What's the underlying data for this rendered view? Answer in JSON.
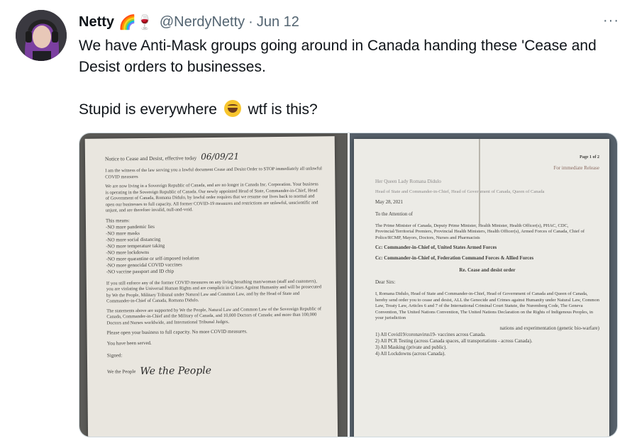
{
  "tweet": {
    "name": "Netty",
    "name_emojis": "🌈🍷",
    "handle": "@NerdyNetty",
    "separator": "·",
    "date": "Jun 12",
    "more": "···",
    "line1": "We have Anti-Mask groups going around in Canada handing these 'Cease and Desist orders to businesses.",
    "line2_a": "Stupid is everywhere",
    "line2_b": "wtf is this?"
  },
  "left_doc": {
    "title": "Notice to Cease and Desist, effective today",
    "date_handwritten": "06/09/21",
    "intro": "I am the witness of the law serving you a lawful document Cease and Desist Order to STOP immediately all unlawful COVID measures",
    "para1": "We are now living in a Sovereign Republic of Canada, and are no longer in Canada Inc. Corporation. Your business is operating in the Sovereign Republic of Canada. Our newly appointed Head of State, Commander-in-Chief, Head of Government of Canada, Romana Didulo, by lawful order requires that we resume our lives back to normal and open our businesses to full capacity. All former COVID-19 measures and restrictions are unlawful, unscientific and unjust, and are therefore invalid, null-and-void.",
    "means": "This means:",
    "list": [
      "-NO more pandemic lies",
      "-NO more masks",
      "-NO more social distancing",
      "-NO more temperature taking",
      "-NO more lockdowns",
      "-NO more quarantine or self-imposed isolation",
      "-NO more genocidal COVID vaccines",
      "-NO vaccine passport and ID chip"
    ],
    "para2": "If you still enforce any of the former COVID measures on any living breathing man/woman (staff and customers), you are violating the Universal Human Rights and are complicit in Crimes Against Humanity and will be prosecuted by We the People, Military Tribunal under Natural Law and Common Law, and by the Head of State and Commander-in-Chief of Canada, Romana Didulo.",
    "para3": "The statements above are supported by We the People, Natural Law and Common Law of the Sovereign Republic of Canada, Commander-in-Chief and the Military of Canada, and 10,000 Doctors of Canada; and more than 100,000 Doctors and Nurses worldwide, and International Tribunal Judges.",
    "para4": "Please open your business to full capacity. No more COVID measures.",
    "served": "You have been served.",
    "signed": "Signed:",
    "we": "We the People",
    "signature": "We the People"
  },
  "right_doc": {
    "page": "Page 1 of 2",
    "release": "For immediate Release",
    "from1": "Her Queen Lady Romana Didulo",
    "from2": "Head of State and Commander-in-Chief, Head of Government of Canada, Queen of Canada",
    "date": "May 28, 2021",
    "attn": "To the Attention of",
    "recipients": "The Prime Minister of Canada, Deputy Prime Minister, Health Minister, Health Officer(s), PHAC, CDC, Provincial/Territorial Premiers, Provincial Health Ministers, Health Officer(s), Armed Forces of Canada, Chief of Police/RCMP, Mayors, Doctors, Nurses and Pharmacists",
    "cc1": "Cc: Commander-in-Chief of, United States Armed Forces",
    "cc2": "Cc: Commander-in-Chief of, Federation Command Forces & Allied Forces",
    "re": "Re. Cease and desist order",
    "dear": "Dear Sirs:",
    "body": "I, Romana Didulo, Head of State and Commander-in-Chief, Head of Government of Canada and Queen of Canada, hereby send order you to cease and desist, ALL the Genocide and Crimes against Humanity under Natural Law, Common Law, Treaty Law, Articles 6 and 7 of the International Criminal Court Statute, the Nuremberg Code, The Geneva Convention, The United Nations Convention, The United Nations Declaration on the Rights of Indigenous Peoples, in your jurisdiction",
    "body2": "nations and experimentation (genetic bio-warfare)",
    "items": [
      "1) All Covid19/coronavirus19- vaccines across Canada.",
      "2) All PCR Testing (across Canada spaces, all transportations - across Canada).",
      "3) All Masking (private and public).",
      "4) All Lockdowns (across Canada)."
    ]
  }
}
